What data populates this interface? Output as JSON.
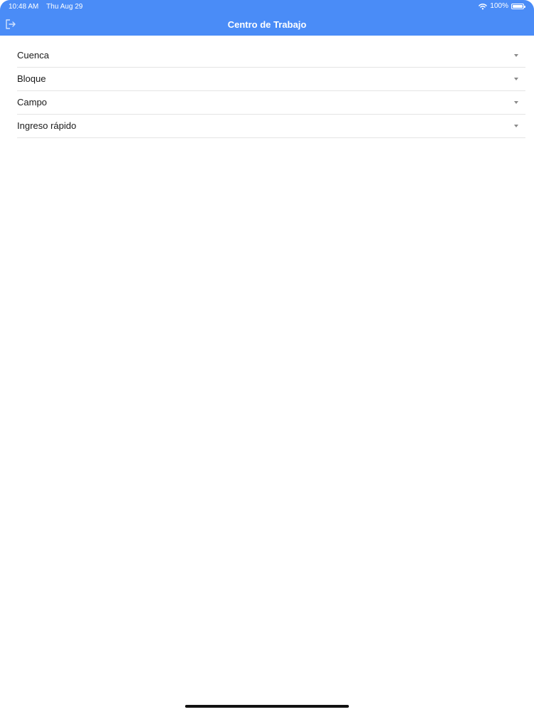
{
  "status_bar": {
    "time": "10:48 AM",
    "date": "Thu Aug 29",
    "battery": "100%",
    "icons": [
      "wifi-icon",
      "battery-icon"
    ]
  },
  "header": {
    "title": "Centro de Trabajo",
    "left_icon": "logout-icon",
    "color": "#4a8cf7"
  },
  "fields": [
    {
      "label": "Cuenca",
      "icon": "chevron-down-icon"
    },
    {
      "label": "Bloque",
      "icon": "chevron-down-icon"
    },
    {
      "label": "Campo",
      "icon": "chevron-down-icon"
    },
    {
      "label": "Ingreso rápido",
      "icon": "chevron-down-icon"
    }
  ]
}
